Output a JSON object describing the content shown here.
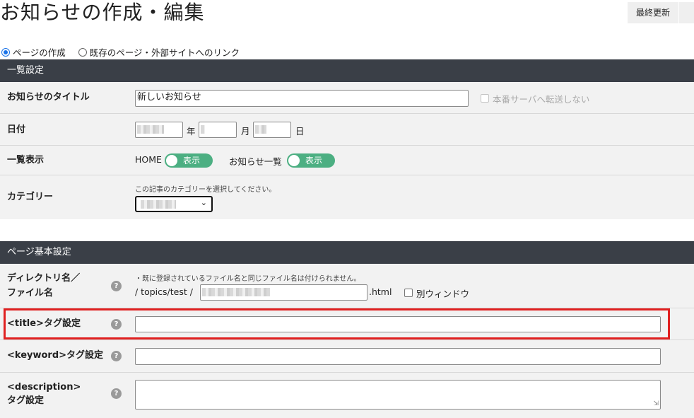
{
  "page": {
    "title": "お知らせの作成・編集",
    "save_label": "最終更新"
  },
  "mode": {
    "options": [
      {
        "label": "ページの作成",
        "checked": true
      },
      {
        "label": "既存のページ・外部サイトへのリンク",
        "checked": false
      }
    ]
  },
  "list_settings": {
    "header": "一覧設定",
    "title_label": "お知らせのタイトル",
    "title_value": "新しいお知らせ",
    "no_transfer_label": "本番サーバへ転送しない",
    "date_label": "日付",
    "year_suffix": "年",
    "month_suffix": "月",
    "day_suffix": "日",
    "display_label": "一覧表示",
    "home_label": "HOME",
    "home_toggle": "表示",
    "news_list_label": "お知らせ一覧",
    "news_toggle": "表示",
    "category_label": "カテゴリー",
    "category_note": "この記事のカテゴリーを選択してください。"
  },
  "page_basic": {
    "header": "ページ基本設定",
    "dir_label_1": "ディレクトリ名／",
    "dir_label_2": "ファイル名",
    "dir_note": "・既に登録されているファイル名と同じファイル名は付けられません。",
    "path_prefix": "/ topics/test /",
    "ext": ".html",
    "new_window_label": "別ウィンドウ",
    "title_tag_label": "<title>タグ設定",
    "keyword_tag_label": "<keyword>タグ設定",
    "desc_label_1": "<description>",
    "desc_label_2": "タグ設定",
    "help_glyph": "?"
  },
  "colors": {
    "header_bg": "#3a3f47",
    "toggle_on": "#4caf82",
    "highlight": "#e02020",
    "row_bg": "#f2f2f2"
  }
}
